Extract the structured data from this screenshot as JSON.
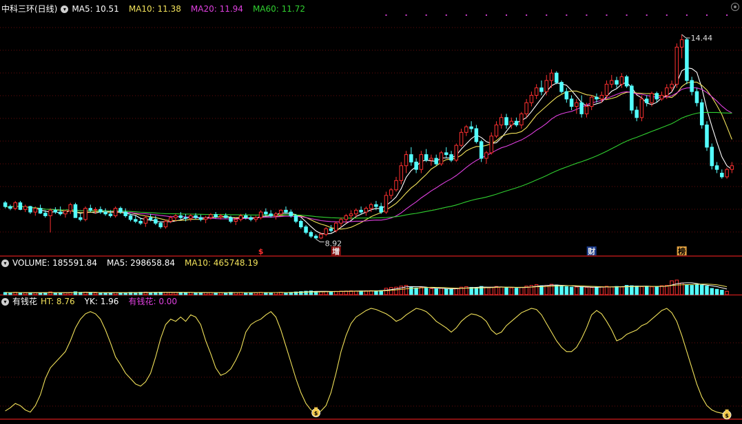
{
  "panels": {
    "price": {
      "title": "中科三环(日线)",
      "indicators": [
        {
          "label": "MA5:",
          "value": "10.51",
          "color": "#ffffff"
        },
        {
          "label": "MA10:",
          "value": "11.38",
          "color": "#f2e25a"
        },
        {
          "label": "MA20:",
          "value": "11.94",
          "color": "#e040e0"
        },
        {
          "label": "MA60:",
          "value": "11.72",
          "color": "#30d030"
        }
      ]
    },
    "volume": {
      "indicators": [
        {
          "label": "VOLUME:",
          "value": "185591.84",
          "color": "#ffffff"
        },
        {
          "label": "MA5:",
          "value": "298658.84",
          "color": "#ffffff"
        },
        {
          "label": "MA10:",
          "value": "465748.19",
          "color": "#f2e25a"
        }
      ]
    },
    "indicator": {
      "title": "有钱花",
      "indicators": [
        {
          "label": "HT:",
          "value": "8.76",
          "color": "#f2e25a"
        },
        {
          "label": "YK:",
          "value": "1.96",
          "color": "#ffffff"
        },
        {
          "label": "有钱花:",
          "value": "0.00",
          "color": "#e040e0"
        }
      ]
    }
  },
  "chart_data": {
    "type": "candlestick",
    "price_range": [
      8.5,
      15.0
    ],
    "high_label": "14.44",
    "low_label": "8.92",
    "events": [
      {
        "label": "$",
        "index": 51,
        "color": "#ff3030"
      },
      {
        "label": "增",
        "index": 66,
        "color": "#e8e8e8",
        "bg": "#8a1010"
      },
      {
        "label": "财",
        "index": 117,
        "color": "#e8e8e8",
        "bg": "#1a3a8a"
      },
      {
        "label": "榜",
        "index": 135,
        "color": "#000000",
        "bg": "#e0a040"
      }
    ],
    "colors": {
      "up": "#ff3030",
      "down": "#54ffff",
      "ma5": "#ffffff",
      "ma10": "#f2e25a",
      "ma20": "#e040e0",
      "ma60": "#30d030",
      "osc": "#f2e25a"
    },
    "ohlc": [
      [
        9.9,
        9.95,
        9.75,
        9.8
      ],
      [
        9.8,
        9.85,
        9.7,
        9.75
      ],
      [
        9.75,
        9.95,
        9.7,
        9.9
      ],
      [
        9.9,
        9.95,
        9.7,
        9.72
      ],
      [
        9.72,
        9.85,
        9.65,
        9.8
      ],
      [
        9.8,
        9.82,
        9.6,
        9.65
      ],
      [
        9.65,
        9.8,
        9.55,
        9.75
      ],
      [
        9.75,
        9.85,
        9.6,
        9.62
      ],
      [
        9.62,
        9.7,
        9.5,
        9.55
      ],
      [
        9.55,
        9.75,
        9.1,
        9.7
      ],
      [
        9.7,
        9.78,
        9.6,
        9.65
      ],
      [
        9.65,
        9.8,
        9.55,
        9.6
      ],
      [
        9.6,
        9.7,
        9.5,
        9.68
      ],
      [
        9.68,
        9.9,
        9.6,
        9.85
      ],
      [
        9.85,
        9.9,
        9.5,
        9.5
      ],
      [
        9.5,
        9.6,
        9.4,
        9.45
      ],
      [
        9.45,
        9.8,
        9.4,
        9.75
      ],
      [
        9.75,
        9.85,
        9.65,
        9.7
      ],
      [
        9.7,
        9.78,
        9.6,
        9.72
      ],
      [
        9.72,
        9.8,
        9.6,
        9.65
      ],
      [
        9.65,
        9.75,
        9.55,
        9.6
      ],
      [
        9.6,
        9.7,
        9.5,
        9.55
      ],
      [
        9.55,
        9.8,
        9.5,
        9.75
      ],
      [
        9.75,
        9.8,
        9.6,
        9.65
      ],
      [
        9.65,
        9.75,
        9.5,
        9.55
      ],
      [
        9.55,
        9.6,
        9.4,
        9.45
      ],
      [
        9.45,
        9.55,
        9.35,
        9.4
      ],
      [
        9.4,
        9.5,
        9.3,
        9.35
      ],
      [
        9.35,
        9.55,
        9.25,
        9.5
      ],
      [
        9.5,
        9.6,
        9.4,
        9.45
      ],
      [
        9.45,
        9.55,
        9.3,
        9.35
      ],
      [
        9.35,
        9.4,
        9.2,
        9.25
      ],
      [
        9.25,
        9.45,
        9.2,
        9.4
      ],
      [
        9.4,
        9.55,
        9.35,
        9.5
      ],
      [
        9.5,
        9.6,
        9.4,
        9.55
      ],
      [
        9.55,
        9.65,
        9.45,
        9.5
      ],
      [
        9.5,
        9.6,
        9.4,
        9.48
      ],
      [
        9.48,
        9.6,
        9.4,
        9.55
      ],
      [
        9.55,
        9.62,
        9.45,
        9.5
      ],
      [
        9.5,
        9.58,
        9.4,
        9.45
      ],
      [
        9.45,
        9.55,
        9.35,
        9.5
      ],
      [
        9.5,
        9.62,
        9.45,
        9.58
      ],
      [
        9.58,
        9.65,
        9.48,
        9.52
      ],
      [
        9.52,
        9.6,
        9.45,
        9.55
      ],
      [
        9.55,
        9.62,
        9.48,
        9.5
      ],
      [
        9.5,
        9.55,
        9.35,
        9.4
      ],
      [
        9.4,
        9.5,
        9.3,
        9.45
      ],
      [
        9.45,
        9.6,
        9.4,
        9.55
      ],
      [
        9.55,
        9.62,
        9.45,
        9.5
      ],
      [
        9.5,
        9.55,
        9.4,
        9.45
      ],
      [
        9.45,
        9.55,
        9.38,
        9.5
      ],
      [
        9.5,
        9.7,
        9.45,
        9.65
      ],
      [
        9.65,
        9.75,
        9.55,
        9.6
      ],
      [
        9.6,
        9.7,
        9.5,
        9.55
      ],
      [
        9.55,
        9.65,
        9.45,
        9.6
      ],
      [
        9.6,
        9.72,
        9.55,
        9.7
      ],
      [
        9.7,
        9.8,
        9.6,
        9.65
      ],
      [
        9.65,
        9.72,
        9.5,
        9.55
      ],
      [
        9.55,
        9.6,
        9.35,
        9.4
      ],
      [
        9.4,
        9.45,
        9.2,
        9.25
      ],
      [
        9.25,
        9.3,
        9.05,
        9.1
      ],
      [
        9.1,
        9.15,
        8.95,
        9.0
      ],
      [
        9.0,
        9.05,
        8.92,
        8.95
      ],
      [
        8.95,
        9.1,
        8.92,
        9.05
      ],
      [
        9.05,
        9.25,
        9.0,
        9.2
      ],
      [
        9.2,
        9.3,
        9.1,
        9.15
      ],
      [
        9.15,
        9.4,
        9.1,
        9.35
      ],
      [
        9.35,
        9.5,
        9.25,
        9.45
      ],
      [
        9.45,
        9.6,
        9.35,
        9.55
      ],
      [
        9.55,
        9.7,
        9.45,
        9.6
      ],
      [
        9.6,
        9.75,
        9.5,
        9.7
      ],
      [
        9.7,
        9.8,
        9.6,
        9.65
      ],
      [
        9.65,
        9.8,
        9.55,
        9.75
      ],
      [
        9.75,
        9.9,
        9.65,
        9.85
      ],
      [
        9.85,
        9.95,
        9.7,
        9.8
      ],
      [
        9.8,
        9.9,
        9.6,
        9.65
      ],
      [
        9.65,
        10.2,
        9.6,
        10.1
      ],
      [
        10.1,
        10.3,
        10.0,
        10.25
      ],
      [
        10.25,
        10.6,
        10.2,
        10.5
      ],
      [
        10.5,
        11.0,
        10.4,
        10.9
      ],
      [
        10.9,
        11.3,
        10.7,
        11.2
      ],
      [
        11.2,
        11.4,
        10.9,
        11.0
      ],
      [
        11.0,
        11.1,
        10.7,
        10.8
      ],
      [
        10.8,
        11.3,
        10.7,
        11.2
      ],
      [
        11.2,
        11.35,
        11.0,
        11.05
      ],
      [
        11.05,
        11.2,
        10.9,
        11.1
      ],
      [
        11.1,
        11.2,
        10.9,
        10.95
      ],
      [
        10.95,
        11.3,
        10.9,
        11.25
      ],
      [
        11.25,
        11.4,
        11.1,
        11.2
      ],
      [
        11.2,
        11.3,
        11.0,
        11.05
      ],
      [
        11.05,
        11.5,
        11.0,
        11.45
      ],
      [
        11.45,
        11.9,
        11.4,
        11.8
      ],
      [
        11.8,
        12.0,
        11.7,
        11.95
      ],
      [
        11.95,
        12.1,
        11.8,
        11.9
      ],
      [
        11.9,
        12.0,
        11.5,
        11.55
      ],
      [
        11.55,
        11.6,
        11.0,
        11.1
      ],
      [
        11.1,
        11.3,
        10.95,
        11.25
      ],
      [
        11.25,
        11.8,
        11.2,
        11.7
      ],
      [
        11.7,
        12.1,
        11.65,
        12.0
      ],
      [
        12.0,
        12.3,
        11.9,
        12.2
      ],
      [
        12.2,
        12.3,
        11.9,
        12.0
      ],
      [
        12.0,
        12.2,
        11.9,
        12.1
      ],
      [
        12.1,
        12.2,
        11.95,
        12.0
      ],
      [
        12.0,
        12.35,
        11.9,
        12.3
      ],
      [
        12.3,
        12.7,
        12.2,
        12.6
      ],
      [
        12.6,
        12.9,
        12.5,
        12.8
      ],
      [
        12.8,
        13.1,
        12.7,
        13.0
      ],
      [
        13.0,
        13.2,
        12.8,
        12.9
      ],
      [
        12.9,
        13.35,
        12.8,
        13.2
      ],
      [
        13.2,
        13.5,
        13.0,
        13.4
      ],
      [
        13.4,
        13.45,
        13.1,
        13.15
      ],
      [
        13.15,
        13.2,
        12.85,
        12.9
      ],
      [
        12.9,
        13.0,
        12.6,
        12.7
      ],
      [
        12.7,
        12.8,
        12.4,
        12.5
      ],
      [
        12.5,
        12.7,
        12.3,
        12.6
      ],
      [
        12.6,
        12.8,
        12.2,
        12.3
      ],
      [
        12.3,
        12.6,
        12.2,
        12.5
      ],
      [
        12.5,
        12.8,
        12.4,
        12.75
      ],
      [
        12.75,
        12.85,
        12.6,
        12.7
      ],
      [
        12.7,
        12.9,
        12.6,
        12.8
      ],
      [
        12.8,
        13.2,
        12.7,
        13.1
      ],
      [
        13.1,
        13.35,
        13.0,
        13.2
      ],
      [
        13.2,
        13.3,
        13.0,
        13.1
      ],
      [
        13.1,
        13.4,
        13.0,
        13.3
      ],
      [
        13.3,
        13.35,
        13.0,
        13.05
      ],
      [
        13.05,
        13.1,
        12.3,
        12.4
      ],
      [
        12.4,
        12.5,
        12.1,
        12.2
      ],
      [
        12.2,
        12.8,
        12.1,
        12.7
      ],
      [
        12.7,
        12.8,
        12.5,
        12.6
      ],
      [
        12.6,
        12.9,
        12.5,
        12.85
      ],
      [
        12.85,
        12.9,
        12.6,
        12.7
      ],
      [
        12.7,
        12.9,
        12.65,
        12.8
      ],
      [
        12.8,
        13.1,
        12.7,
        13.0
      ],
      [
        13.0,
        13.2,
        12.9,
        13.1
      ],
      [
        13.1,
        14.2,
        13.0,
        14.1
      ],
      [
        14.1,
        14.44,
        13.8,
        14.3
      ],
      [
        14.3,
        14.35,
        13.1,
        13.2
      ],
      [
        13.2,
        13.3,
        12.8,
        12.9
      ],
      [
        12.9,
        13.0,
        12.5,
        12.6
      ],
      [
        12.6,
        12.7,
        11.9,
        12.0
      ],
      [
        12.0,
        12.1,
        11.3,
        11.4
      ],
      [
        11.4,
        11.5,
        10.8,
        10.9
      ],
      [
        10.9,
        11.0,
        10.7,
        10.8
      ],
      [
        10.7,
        10.8,
        10.55,
        10.6
      ],
      [
        10.6,
        10.85,
        10.55,
        10.8
      ],
      [
        10.8,
        11.0,
        10.7,
        10.9
      ]
    ],
    "volume_range": [
      0,
      1400000
    ],
    "volume": [
      120000,
      110000,
      130000,
      105000,
      100000,
      115000,
      98000,
      108000,
      112000,
      150000,
      100000,
      95000,
      102000,
      120000,
      160000,
      130000,
      140000,
      110000,
      98000,
      95000,
      100000,
      105000,
      118000,
      102000,
      110000,
      125000,
      120000,
      130000,
      140000,
      118000,
      125000,
      135000,
      128000,
      132000,
      120000,
      115000,
      110000,
      118000,
      112000,
      108000,
      115000,
      122000,
      110000,
      105000,
      112000,
      128000,
      118000,
      125000,
      110000,
      105000,
      108000,
      130000,
      120000,
      112000,
      115000,
      128000,
      118000,
      125000,
      150000,
      170000,
      190000,
      205000,
      180000,
      165000,
      178000,
      172000,
      185000,
      195000,
      200000,
      210000,
      198000,
      205000,
      212000,
      220000,
      215000,
      230000,
      360000,
      400000,
      420000,
      480000,
      520000,
      440000,
      380000,
      410000,
      360000,
      340000,
      320000,
      350000,
      330000,
      300000,
      360000,
      420000,
      450000,
      410000,
      400000,
      460000,
      390000,
      420000,
      460000,
      430000,
      400000,
      380000,
      360000,
      410000,
      480000,
      520000,
      560000,
      500000,
      520000,
      580000,
      540000,
      480000,
      450000,
      420000,
      430000,
      440000,
      410000,
      400000,
      420000,
      450000,
      470000,
      440000,
      460000,
      430000,
      520000,
      500000,
      480000,
      450000,
      470000,
      440000,
      460000,
      500000,
      520000,
      780000,
      820000,
      650000,
      560000,
      520000,
      580000,
      540000,
      480000,
      350000,
      300000,
      250000,
      185591
    ],
    "oscillator_range": [
      0,
      100
    ],
    "oscillator": [
      5,
      8,
      12,
      10,
      6,
      4,
      10,
      20,
      35,
      45,
      50,
      55,
      60,
      70,
      82,
      90,
      95,
      97,
      95,
      90,
      80,
      68,
      55,
      48,
      40,
      35,
      30,
      28,
      32,
      40,
      55,
      72,
      85,
      90,
      88,
      92,
      88,
      94,
      92,
      85,
      70,
      58,
      45,
      38,
      40,
      44,
      52,
      62,
      78,
      85,
      88,
      90,
      94,
      97,
      92,
      80,
      65,
      50,
      35,
      22,
      12,
      6,
      4,
      5,
      10,
      22,
      40,
      60,
      75,
      86,
      92,
      95,
      98,
      100,
      99,
      97,
      95,
      92,
      88,
      90,
      94,
      97,
      100,
      99,
      97,
      93,
      88,
      85,
      82,
      78,
      82,
      88,
      92,
      95,
      94,
      92,
      88,
      80,
      76,
      78,
      84,
      88,
      92,
      96,
      98,
      100,
      99,
      94,
      86,
      78,
      70,
      64,
      60,
      60,
      64,
      72,
      82,
      94,
      98,
      95,
      88,
      80,
      70,
      72,
      76,
      78,
      80,
      84,
      86,
      90,
      94,
      98,
      100,
      96,
      88,
      75,
      60,
      45,
      30,
      18,
      10,
      6,
      4,
      3,
      2
    ]
  }
}
